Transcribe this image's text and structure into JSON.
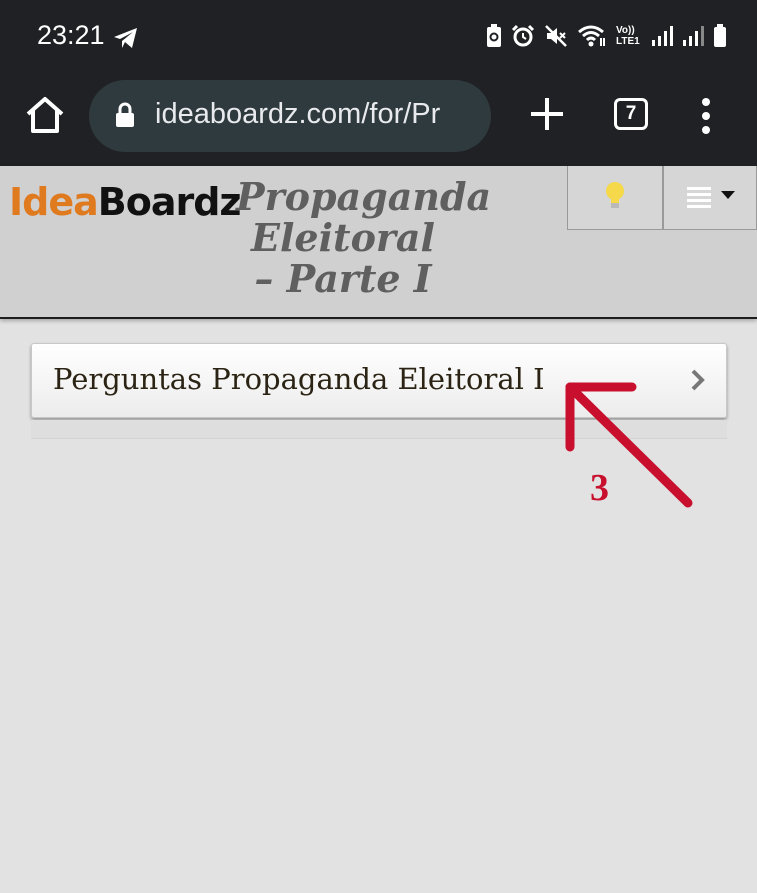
{
  "status_bar": {
    "time": "23:21",
    "icons": [
      "telegram-icon",
      "battery-saver-icon",
      "alarm-icon",
      "mute-icon",
      "wifi-icon",
      "volte-icon",
      "signal-icon",
      "signal-icon",
      "battery-icon"
    ],
    "volte_label": "Vo)) LTE1"
  },
  "browser": {
    "url": "ideaboardz.com/for/Pr",
    "tab_count": "7"
  },
  "site": {
    "logo_part1": "Idea",
    "logo_part2": "Boardz",
    "board_title": "Propaganda Eleitoral – Parte I"
  },
  "content": {
    "items": [
      {
        "label": "Perguntas Propaganda Eleitoral I"
      }
    ]
  },
  "annotation": {
    "number": "3",
    "color": "#c8102e"
  },
  "colors": {
    "chrome_bg": "#202124",
    "url_bar_bg": "#2f3a3f",
    "logo_accent": "#e07a1f",
    "page_bg": "#e2e2e2"
  }
}
